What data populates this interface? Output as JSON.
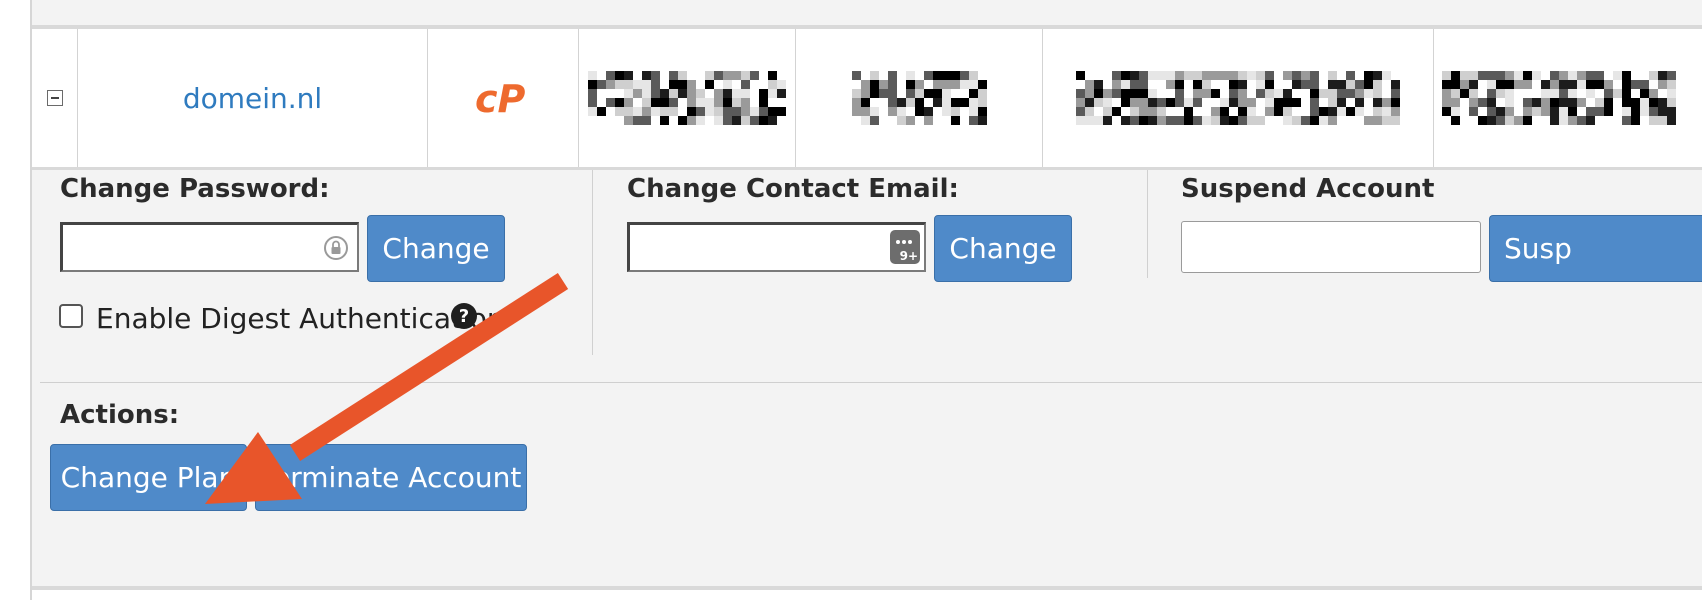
{
  "row": {
    "collapse_icon": "minus-square-icon",
    "domain": "domein.nl",
    "logo_icon": "cpanel-logo-icon",
    "logo_text": "cP"
  },
  "password": {
    "label": "Change Password:",
    "value": "",
    "button": "Change",
    "field_icon": "password-manager-icon",
    "digest_label": "Enable Digest Authentication",
    "digest_checked": false,
    "help_icon": "question-circle-icon",
    "help_glyph": "?"
  },
  "contact": {
    "label": "Change Contact Email:",
    "value": "",
    "button": "Change",
    "field_icon": "contacts-badge-icon",
    "badge_text": "9+"
  },
  "suspend": {
    "label": "Suspend Account",
    "value": "",
    "button": "Susp"
  },
  "actions": {
    "label": "Actions:",
    "change_plan": "Change Plan",
    "terminate": "Terminate Account"
  },
  "annotation": {
    "arrow_icon": "annotation-arrow-icon",
    "color": "#e8552a"
  },
  "colors": {
    "button_blue": "#4f8ac9",
    "link_blue": "#2f7bbf",
    "cpanel_orange": "#ee6a2e"
  }
}
